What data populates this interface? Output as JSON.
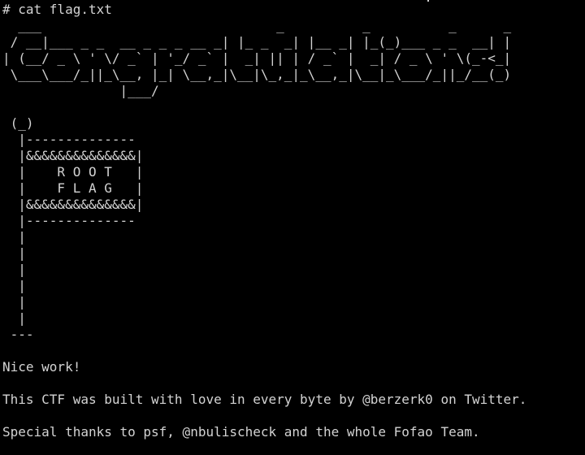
{
  "terminal": {
    "prompt": "# cat flag.txt",
    "banner": [
      "  ___                              _          _          _      _            _ ",
      " / __|___ _ _  __ _ _ _ __ _| |_ _  _| |__ _| |_(_)___ _ _  __| |",
      "| (__/ _ \\ ' \\/ _` | '_/ _` |  _| || | / _` |  _| / _ \\ ' \\(_-<_|",
      " \\___\\___/_||_\\__, |_| \\__,_|\\__|\\_,_|_\\__,_|\\__|_\\___/_||_/__(_)",
      "               |___/"
    ],
    "flag_art": [
      " (_)",
      "  |--------------",
      "  |&&&&&&&&&&&&&&|",
      "  |    R O O T   |",
      "  |    F L A G   |",
      "  |&&&&&&&&&&&&&&|",
      "  |--------------",
      "  |",
      "  |",
      "  |",
      "  |",
      "  |",
      "  |",
      " ---"
    ],
    "message_1": "Nice work!",
    "message_2": "This CTF was built with love in every byte by @berzerk0 on Twitter.",
    "message_3": "Special thanks to psf, @nbulischeck and the whole Fofao Team.",
    "colors": {
      "background": "#000000",
      "text": "#d3d3d3"
    }
  }
}
